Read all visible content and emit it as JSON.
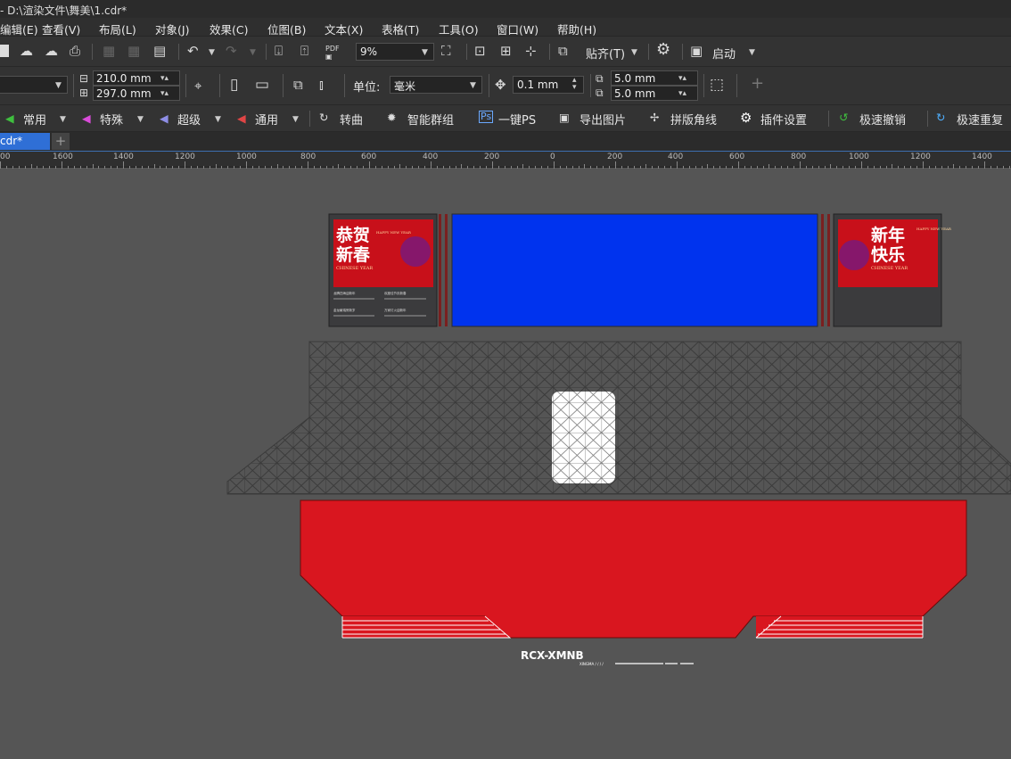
{
  "title": "- D:\\渲染文件\\舞美\\1.cdr*",
  "menu": [
    "编辑(E)",
    "查看(V)",
    "布局(L)",
    "对象(J)",
    "效果(C)",
    "位图(B)",
    "文本(X)",
    "表格(T)",
    "工具(O)",
    "窗口(W)",
    "帮助(H)"
  ],
  "toolbar1": {
    "zoom": "9%",
    "snap_label": "贴齐(T)",
    "launch_label": "启动"
  },
  "toolbar2": {
    "width": "210.0 mm",
    "height": "297.0 mm",
    "unit_label": "单位:",
    "unit_value": "毫米",
    "nudge": "0.1 mm",
    "dup_x": "5.0 mm",
    "dup_y": "5.0 mm"
  },
  "toolbar3": [
    "常用",
    "特殊",
    "超级",
    "通用",
    "转曲",
    "智能群组",
    "一键PS",
    "导出图片",
    "拼版角线",
    "插件设置",
    "极速撤销",
    "极速重复"
  ],
  "tab_label": "cdr*",
  "ruler_labels": [
    "00",
    "1600",
    "1400",
    "1200",
    "1000",
    "800",
    "600",
    "400",
    "200",
    "0",
    "200",
    "400",
    "600",
    "800",
    "1000",
    "1200",
    "1400"
  ],
  "canvas": {
    "left_poster": {
      "title1": "恭贺",
      "title2": "新春",
      "en": "HAPPY NEW YEAR",
      "sub": "CHINESE YEAR"
    },
    "right_poster": {
      "title1": "新年",
      "title2": "快乐",
      "en": "HAPPY NEW YEAR",
      "sub": "CHINESE YEAR"
    },
    "left_notes": [
      "龙腾四海迎新年",
      "欢度佳节庆新春",
      "金龙献瑞贺新岁",
      "万家灯火迎新年"
    ],
    "caption_main": "RCX-XMNB",
    "caption_sub": "XINGMA / / / /",
    "colors": {
      "screen": "#0033ee",
      "stage": "#d9161f",
      "truss": "#3a3a3a",
      "poster_red": "#c8101a"
    }
  }
}
